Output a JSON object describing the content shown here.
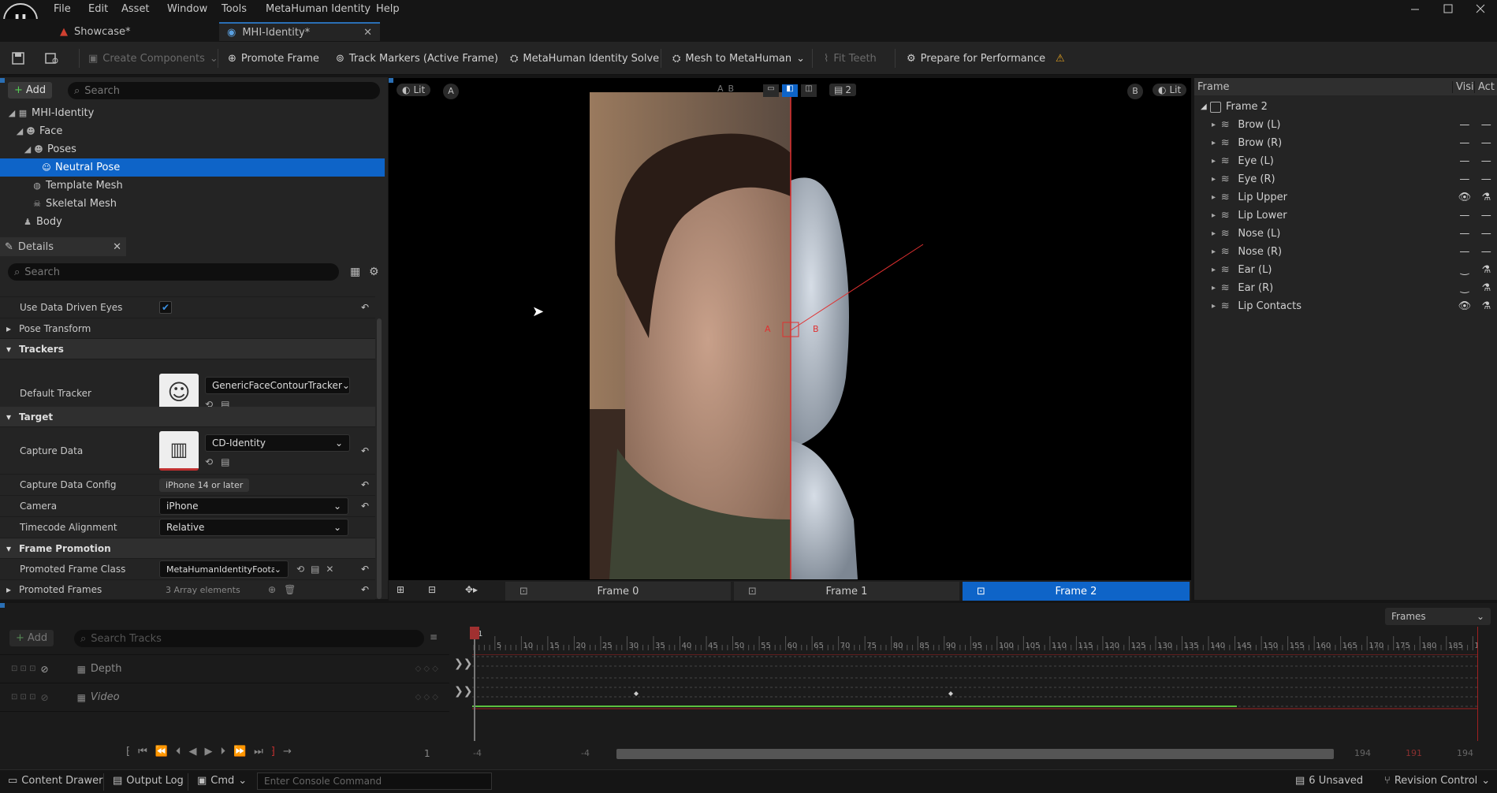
{
  "menu": [
    "File",
    "Edit",
    "Asset",
    "Window",
    "Tools",
    "MetaHuman Identity",
    "Help"
  ],
  "tabs": [
    {
      "label": "Showcase*"
    },
    {
      "label": "MHI-Identity*"
    }
  ],
  "toolbar": {
    "create_components": "Create Components",
    "promote_frame": "Promote Frame",
    "track_markers": "Track Markers (Active Frame)",
    "identity_solve": "MetaHuman Identity Solve",
    "mesh_to_metahuman": "Mesh to MetaHuman",
    "fit_teeth": "Fit Teeth",
    "prepare_performance": "Prepare for Performance"
  },
  "outliner": {
    "add_label": "Add",
    "search_placeholder": "Search",
    "items": [
      {
        "label": "MHI-Identity"
      },
      {
        "label": "Face"
      },
      {
        "label": "Poses"
      },
      {
        "label": "Neutral Pose"
      },
      {
        "label": "Template Mesh"
      },
      {
        "label": "Skeletal Mesh"
      },
      {
        "label": "Body"
      }
    ]
  },
  "details": {
    "tab_label": "Details",
    "search_placeholder": "Search",
    "use_data_driven_eyes": "Use Data Driven Eyes",
    "pose_transform": "Pose Transform",
    "trackers_section": "Trackers",
    "default_tracker": "Default Tracker",
    "tracker_value": "GenericFaceContourTracker",
    "target_section": "Target",
    "capture_data": "Capture Data",
    "capture_data_value": "CD-Identity",
    "capture_data_config": "Capture Data Config",
    "capture_data_config_value": "iPhone 14 or later",
    "camera": "Camera",
    "camera_value": "iPhone",
    "timecode_alignment": "Timecode Alignment",
    "timecode_value": "Relative",
    "frame_promotion_section": "Frame Promotion",
    "promoted_frame_class": "Promoted Frame Class",
    "promoted_frame_class_value": "MetaHumanIdentityFootag",
    "promoted_frames": "Promoted Frames",
    "promoted_frames_value": "3 Array elements"
  },
  "viewport": {
    "lit_left": "Lit",
    "a_label": "A",
    "b_label": "B",
    "lit_right": "Lit",
    "view_count": "2",
    "marker_a": "A",
    "marker_b": "B",
    "frames": [
      "Frame 0",
      "Frame 1",
      "Frame 2"
    ],
    "active_frame": 2
  },
  "frame_panel": {
    "col_frame": "Frame",
    "col_visibility": "Visi",
    "col_active": "Act",
    "root": "Frame 2",
    "items": [
      {
        "label": "Brow (L)",
        "vis": "dash"
      },
      {
        "label": "Brow (R)",
        "vis": "dash"
      },
      {
        "label": "Eye (L)",
        "vis": "dash"
      },
      {
        "label": "Eye (R)",
        "vis": "dash"
      },
      {
        "label": "Lip Upper",
        "vis": "eye"
      },
      {
        "label": "Lip Lower",
        "vis": "dash"
      },
      {
        "label": "Nose (L)",
        "vis": "dash"
      },
      {
        "label": "Nose (R)",
        "vis": "dash"
      },
      {
        "label": "Ear (L)",
        "vis": "closed"
      },
      {
        "label": "Ear (R)",
        "vis": "closed"
      },
      {
        "label": "Lip Contacts",
        "vis": "eye"
      }
    ]
  },
  "timeline": {
    "add_label": "Add",
    "search_placeholder": "Search Tracks",
    "frames_dropdown": "Frames",
    "tracks": [
      {
        "label": "Depth"
      },
      {
        "label": "Video"
      }
    ],
    "current_frame": "1",
    "ticks": [
      "5",
      "10",
      "15",
      "20",
      "25",
      "30",
      "35",
      "40",
      "45",
      "50",
      "55",
      "60",
      "65",
      "70",
      "75",
      "80",
      "85",
      "90",
      "95",
      "100",
      "105",
      "110",
      "115",
      "120",
      "125",
      "130",
      "135",
      "140",
      "145",
      "150",
      "155",
      "160",
      "165",
      "170",
      "175",
      "180",
      "185",
      "190"
    ],
    "playhead_label": "1",
    "range_start_a": "-4",
    "range_start_b": "-4",
    "range_end_a": "194",
    "range_end_mid": "191",
    "range_end_b": "194",
    "frame_field": "1"
  },
  "status": {
    "content_drawer": "Content Drawer",
    "output_log": "Output Log",
    "cmd": "Cmd",
    "console_placeholder": "Enter Console Command",
    "unsaved": "6 Unsaved",
    "revision_control": "Revision Control"
  },
  "colors": {
    "accent": "#0e64c8",
    "panel": "#242424",
    "background": "#151515",
    "marker": "#e03030"
  }
}
